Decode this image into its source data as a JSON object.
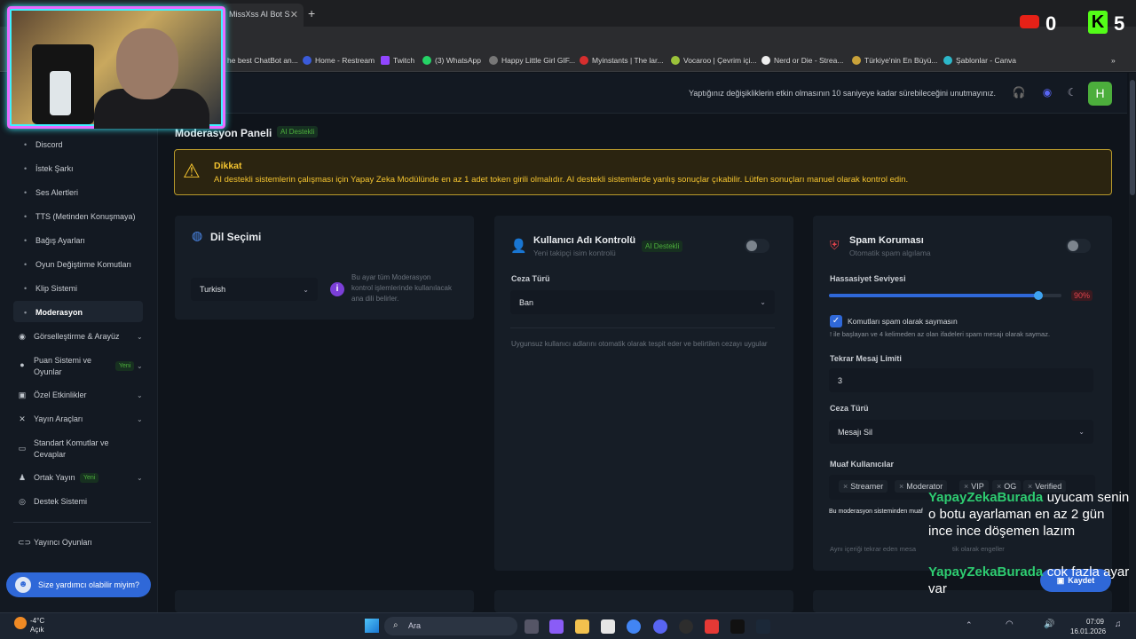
{
  "browser": {
    "tab_title": "MissXss AI Bot S",
    "new_tab": "+",
    "bookmarks": [
      "he best ChatBot an...",
      "Home - Restream",
      "Twitch",
      "(3) WhatsApp",
      "Happy Little Girl GIF...",
      "Myinstants | The lar...",
      "Vocaroo | Çevrim içi...",
      "Nerd or Die - Strea...",
      "Türkiye'nin En Büyü...",
      "Şablonlar - Canva"
    ],
    "more": "»"
  },
  "header": {
    "notice": "Yaptığınız değişikliklerin etkin olmasının 10 saniyeye kadar sürebileceğini unutmayınız.",
    "avatar": "H"
  },
  "sidebar": {
    "sub_items": [
      "Discord",
      "İstek Şarkı",
      "Ses Alertleri",
      "TTS (Metinden Konuşmaya)",
      "Bağış Ayarları",
      "Oyun Değiştirme Komutları",
      "Klip Sistemi",
      "Moderasyon"
    ],
    "main_items": [
      {
        "label": "Görselleştirme & Arayüz"
      },
      {
        "label": "Puan Sistemi ve Oyunlar",
        "badge": "Yeni"
      },
      {
        "label": "Özel Etkinlikler"
      },
      {
        "label": "Yayın Araçları"
      },
      {
        "label": "Standart Komutlar ve Cevaplar"
      },
      {
        "label": "Ortak Yayın",
        "badge": "Yeni"
      },
      {
        "label": "Destek Sistemi"
      },
      {
        "label": "Yayıncı Oyunları"
      }
    ],
    "help_button": "Size yardımcı olabilir miyim?"
  },
  "page": {
    "title": "Moderasyon Paneli",
    "ai_badge": "AI Destekli",
    "warning": {
      "title": "Dikkat",
      "text": "AI destekli sistemlerin çalışması için Yapay Zeka Modülünde en az 1 adet token girili olmalıdır. AI destekli sistemlerde yanlış sonuçlar çıkabilir. Lütfen sonuçları manuel olarak kontrol edin."
    }
  },
  "lang_card": {
    "title": "Dil Seçimi",
    "value": "Turkish",
    "info": "Bu ayar tüm Moderasyon kontrol işlemlerinde kullanılacak ana dili belirler."
  },
  "user_card": {
    "title": "Kullanıcı Adı Kontrolü",
    "subtitle": "Yeni takipçi isim kontrolü",
    "badge": "AI Destekli",
    "penalty_label": "Ceza Türü",
    "penalty_value": "Ban",
    "description": "Uygunsuz kullanıcı adlarını otomatik olarak tespit eder ve belirtilen cezayı uygular"
  },
  "spam_card": {
    "title": "Spam Koruması",
    "subtitle": "Otomatik spam algılama",
    "sensitivity_label": "Hassasiyet Seviyesi",
    "sensitivity": 90,
    "sensitivity_text": "90%",
    "checkbox_label": "Komutları spam olarak saymasın",
    "checkbox_help": "! ile başlayan ve 4 kelimeden az olan ifadeleri spam mesajı olarak saymaz.",
    "repeat_label": "Tekrar Mesaj Limiti",
    "repeat_value": "3",
    "penalty_label": "Ceza Türü",
    "penalty_value": "Mesajı Sil",
    "exempt_label": "Muaf Kullanıcılar",
    "exempt_users": [
      "Streamer",
      "Moderator",
      "VIP",
      "OG",
      "Verified"
    ],
    "exempt_help": "Bu moderasyon sisteminden muaf",
    "bottom_text": "Aynı içeriği tekrar eden mesa",
    "bottom_text2": "tik olarak engeller"
  },
  "save_button": "Kaydet",
  "overlay": {
    "yt_count": "0",
    "kick_letter": "K",
    "kick_count": "5",
    "chat": [
      {
        "name": "YapayZekaBurada",
        "text": "uyucam senin o botu ayarlaman en az 2 gün ince ince döşemen lazım"
      },
      {
        "name": "YapayZekaBurada",
        "text": "cok fazla ayar var"
      }
    ]
  },
  "taskbar": {
    "weather_temp": "-4°C",
    "weather_desc": "Açık",
    "search": "Ara",
    "time": "07:09",
    "date": "16.01.2026"
  }
}
